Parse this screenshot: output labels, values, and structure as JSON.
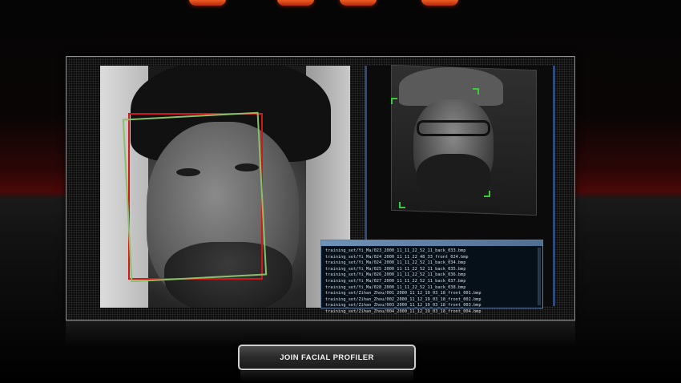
{
  "button": {
    "label": "JOIN FACIAL PROFILER"
  },
  "console": {
    "lines": [
      "training_set/Yi_Ma/023_2000_11_11_22_52_11_back_033.bmp",
      "training_set/Yi_Ma/024_2000_11_11_22_48_33_front_024.bmp",
      "training_set/Yi_Ma/024_2000_11_11_22_52_11_back_034.bmp",
      "training_set/Yi_Ma/025_2000_11_11_22_52_11_back_035.bmp",
      "training_set/Yi_Ma/026_2000_11_11_22_52_11_back_036.bmp",
      "training_set/Yi_Ma/027_2000_11_11_22_52_11_back_037.bmp",
      "training_set/Yi_Ma/028_2000_11_11_22_52_11_back_038.bmp",
      "training_set/Zihan_Zhou/001_2000_11_12_19_03_18_front_001.bmp",
      "training_set/Zihan_Zhou/002_2000_11_12_19_03_18_front_002.bmp",
      "training_set/Zihan_Zhou/003_2000_11_12_19_03_18_front_003.bmp",
      "training_set/Zihan_Zhou/004_2000_11_12_19_03_18_front_004.bmp"
    ]
  },
  "colors": {
    "detection_box_red": "#d01818",
    "detection_box_green": "#8bbf6a",
    "landmark_green": "#3aca3a",
    "logo_orange": "#ff6a2a",
    "window_border_blue": "#2d4a7a"
  }
}
